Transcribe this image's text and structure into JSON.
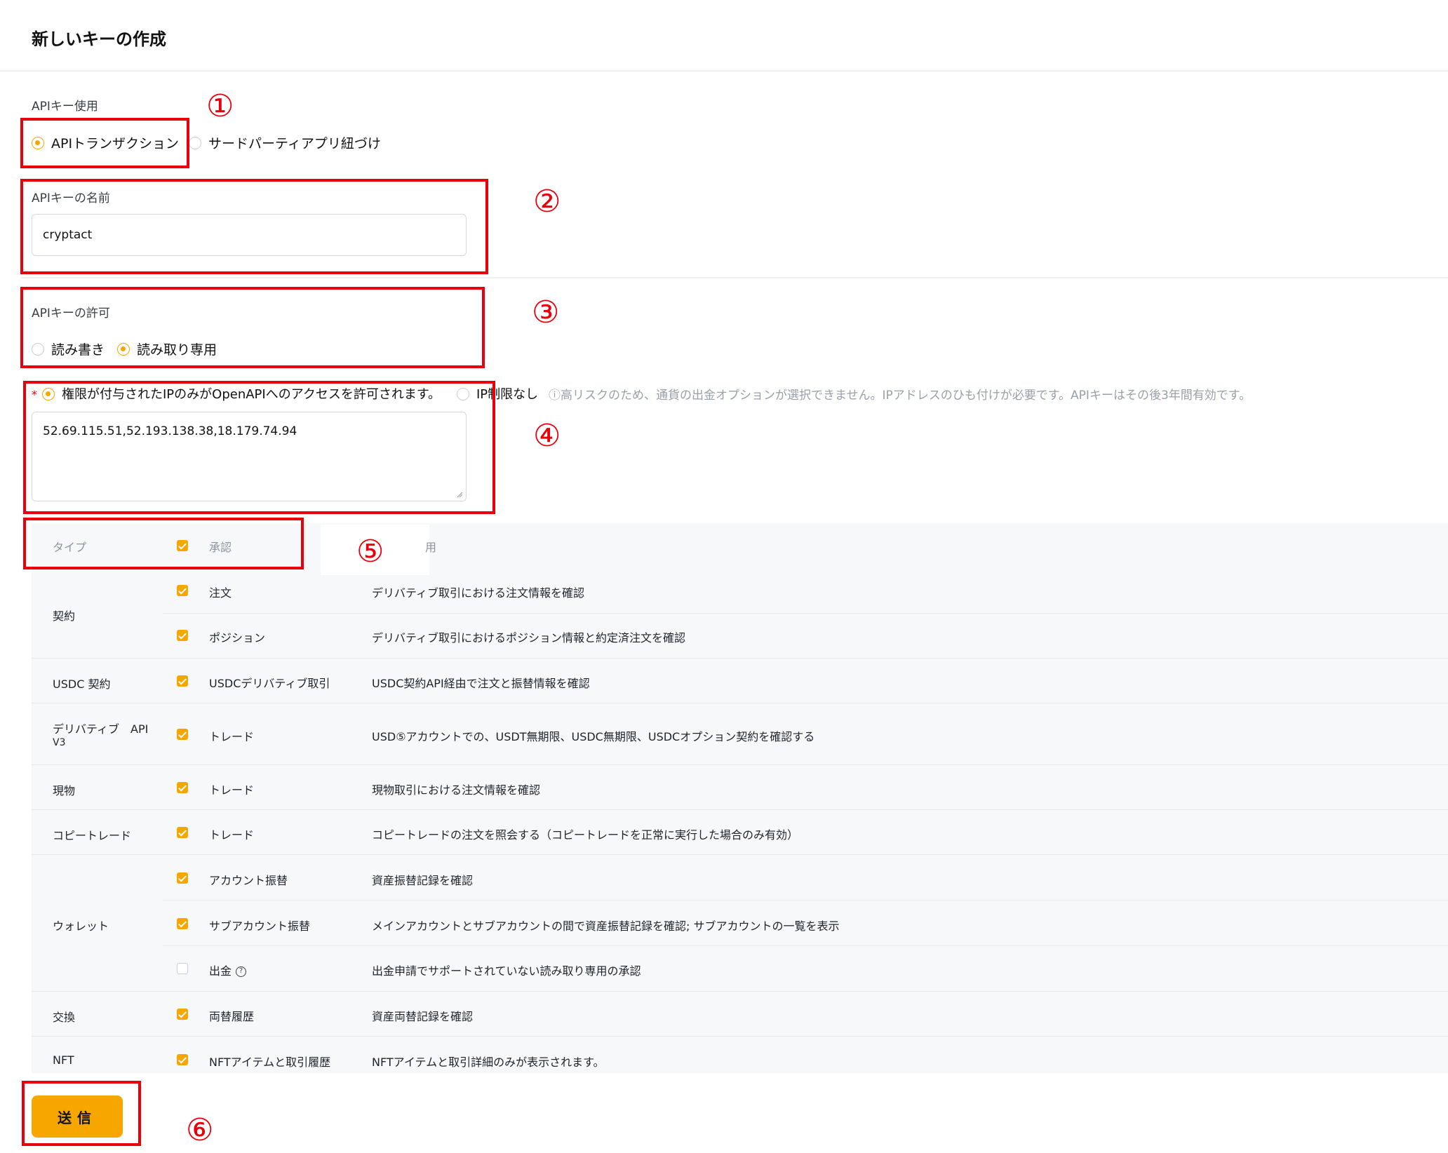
{
  "page": {
    "title": "新しいキーの作成"
  },
  "api_usage": {
    "label": "APIキー使用",
    "options": [
      {
        "label": "APIトランザクション",
        "selected": true
      },
      {
        "label": "サードパーティアプリ紐づけ",
        "selected": false
      }
    ]
  },
  "api_name": {
    "label": "APIキーの名前",
    "value": "cryptact"
  },
  "permission": {
    "label": "APIキーの許可",
    "options": [
      {
        "label": "読み書き",
        "selected": false
      },
      {
        "label": "読み取り専用",
        "selected": true
      }
    ]
  },
  "ip_access": {
    "required_mark": "*",
    "restricted_label": "権限が付与されたIPのみがOpenAPIへのアクセスを許可されます。",
    "unrestricted_label": "IP制限なし",
    "hint": "ⓘ高リスクのため、通貨の出金オプションが選択できません。IPアドレスのひも付けが必要です。APIキーはその後3年間有効です。",
    "value": "52.69.115.51,52.193.138.38,18.179.74.94"
  },
  "table": {
    "headers": {
      "type": "タイプ",
      "approval": "承認",
      "usage_tail": "用"
    },
    "groups": [
      {
        "type": "契約",
        "rows": [
          {
            "name": "注文",
            "desc": "デリバティブ取引における注文情報を確認",
            "checked": true
          },
          {
            "name": "ポジション",
            "desc": "デリバティブ取引におけるポジション情報と約定済注文を確認",
            "checked": true
          }
        ]
      },
      {
        "type": "USDC 契約",
        "rows": [
          {
            "name": "USDCデリバティブ取引",
            "desc": "USDC契約API経由で注文と振替情報を確認",
            "checked": true
          }
        ]
      },
      {
        "type_line1": "デリバティブ　API",
        "type_line2": "V3",
        "rows": [
          {
            "name": "トレード",
            "desc": "USD⑤アカウントでの、USDT無期限、USDC無期限、USDCオプション契約を確認する",
            "checked": true
          }
        ]
      },
      {
        "type": "現物",
        "rows": [
          {
            "name": "トレード",
            "desc": "現物取引における注文情報を確認",
            "checked": true
          }
        ]
      },
      {
        "type": "コピートレード",
        "rows": [
          {
            "name": "トレード",
            "desc": "コピートレードの注文を照会する（コピートレードを正常に実行した場合のみ有効）",
            "checked": true
          }
        ]
      },
      {
        "type": "ウォレット",
        "rows": [
          {
            "name": "アカウント振替",
            "desc": "資産振替記録を確認",
            "checked": true
          },
          {
            "name": "サブアカウント振替",
            "desc": "メインアカウントとサブアカウントの間で資産振替記録を確認; サブアカウントの一覧を表示",
            "checked": true
          },
          {
            "name": "出金",
            "desc": "出金申請でサポートされていない読み取り専用の承認",
            "checked": false,
            "help_icon": "?"
          }
        ]
      },
      {
        "type": "交換",
        "rows": [
          {
            "name": "両替履歴",
            "desc": "資産両替記録を確認",
            "checked": true
          }
        ]
      },
      {
        "type": "NFT",
        "rows": [
          {
            "name": "NFTアイテムと取引履歴",
            "desc": "NFTアイテムと取引詳細のみが表示されます。",
            "checked": true
          }
        ]
      }
    ]
  },
  "submit": {
    "label": "送信"
  },
  "annotations": [
    "①",
    "②",
    "③",
    "④",
    "⑤",
    "⑥"
  ],
  "colors": {
    "accent": "#f7a600",
    "annotation_red": "#e8000b",
    "table_bg": "#f7f8fa"
  }
}
